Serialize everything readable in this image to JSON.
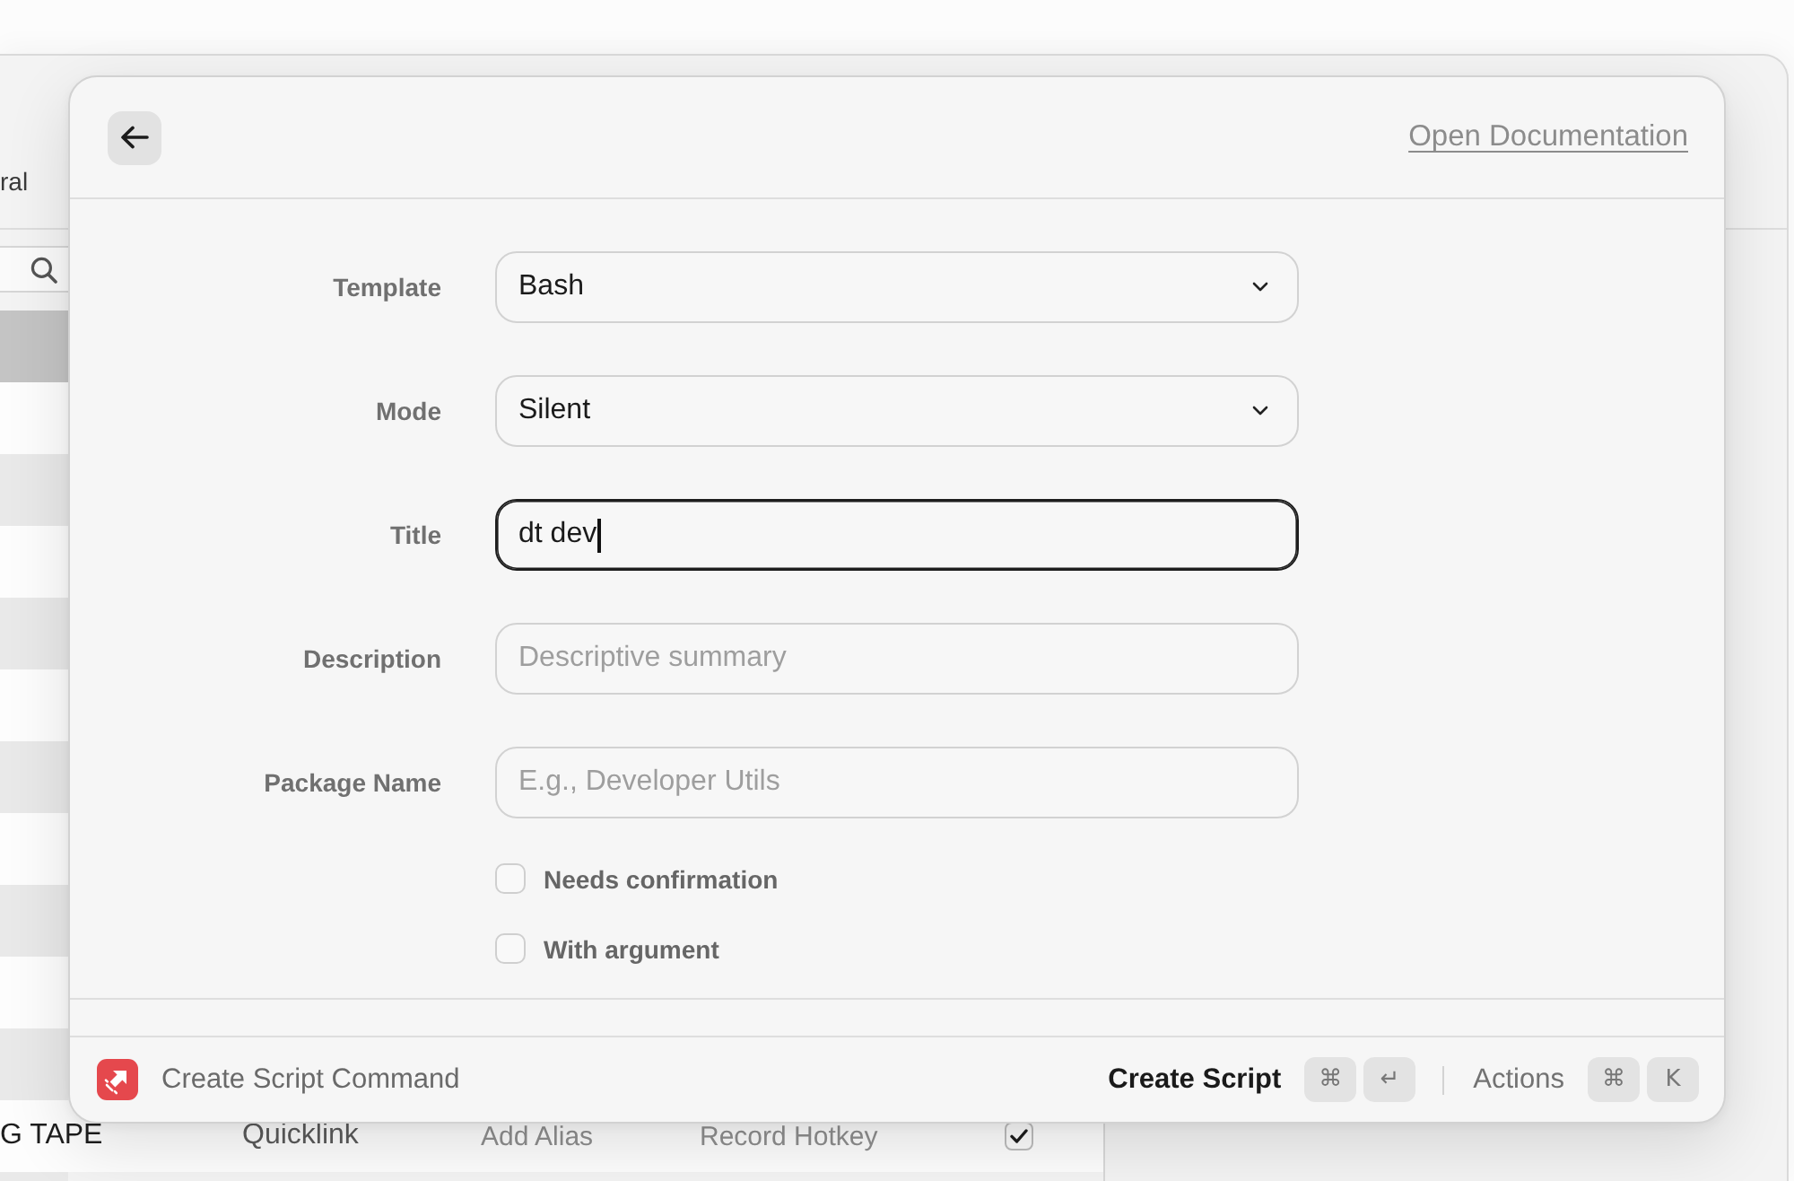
{
  "background_window": {
    "tab": "ral",
    "rows": [
      {
        "selected": true
      },
      {
        "selected": false
      },
      {
        "selected": false
      },
      {
        "selected": false
      },
      {
        "selected": false
      },
      {
        "selected": false
      },
      {
        "selected": false
      },
      {
        "selected": false
      },
      {
        "selected": false
      },
      {
        "selected": false
      },
      {
        "selected": false
      },
      {
        "selected": false,
        "cells": [
          "G TAPE",
          "Quicklink",
          "Add Alias",
          "Record Hotkey"
        ],
        "checked": true
      },
      {
        "selected": false
      }
    ]
  },
  "dialog": {
    "link": "Open Documentation",
    "fields": [
      {
        "kind": "select",
        "label": "Template",
        "value": "Bash",
        "focused": false
      },
      {
        "kind": "select",
        "label": "Mode",
        "value": "Silent",
        "focused": false
      },
      {
        "kind": "text",
        "label": "Title",
        "value": "dt dev",
        "focused": true
      },
      {
        "kind": "text",
        "label": "Description",
        "placeholder": "Descriptive summary",
        "focused": false
      },
      {
        "kind": "text",
        "label": "Package Name",
        "placeholder": "E.g., Developer Utils",
        "focused": false
      }
    ],
    "checkboxes": [
      {
        "label": "Needs confirmation",
        "checked": false
      },
      {
        "label": "With argument",
        "checked": false
      }
    ],
    "footer": {
      "title": "Create Script Command",
      "actions": [
        {
          "kind": "primary",
          "label": "Create Script",
          "keys": [
            "⌘",
            "↵"
          ]
        },
        {
          "kind": "secondary",
          "label": "Actions",
          "keys": [
            "⌘",
            "K"
          ]
        }
      ]
    }
  }
}
